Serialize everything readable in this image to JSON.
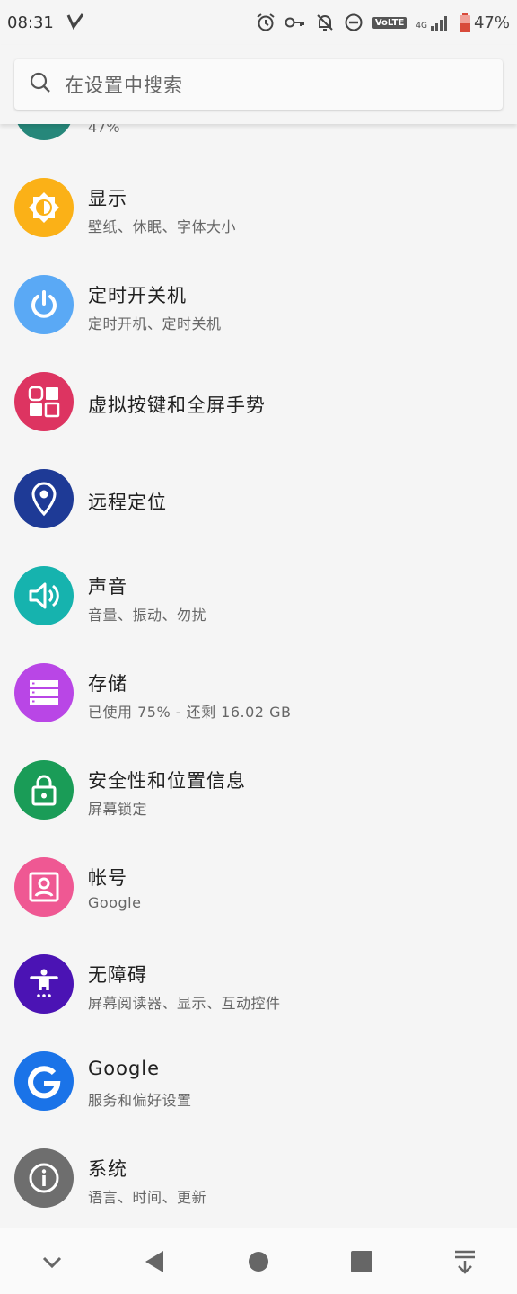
{
  "status_bar": {
    "time": "08:31",
    "volte": "VoLTE",
    "battery_percent": "47%",
    "network": "4G",
    "icons": [
      "vpn-check-icon",
      "alarm-icon",
      "key-icon",
      "notifications-off-icon",
      "do-not-disturb-icon",
      "volte-icon",
      "signal-icon",
      "battery-icon"
    ]
  },
  "search": {
    "placeholder": "在设置中搜索"
  },
  "partial_item": {
    "subtitle": "47%",
    "color": "#26877a"
  },
  "settings": [
    {
      "id": "display",
      "title": "显示",
      "subtitle": "壁纸、休眠、字体大小",
      "color": "#fbb117",
      "icon": "brightness-icon"
    },
    {
      "id": "schedule-power",
      "title": "定时开关机",
      "subtitle": "定时开机、定时关机",
      "color": "#5aa9f5",
      "icon": "power-icon"
    },
    {
      "id": "nav-gestures",
      "title": "虚拟按键和全屏手势",
      "subtitle": "",
      "color": "#dd3461",
      "icon": "apps-icon"
    },
    {
      "id": "remote-location",
      "title": "远程定位",
      "subtitle": "",
      "color": "#1e3a96",
      "icon": "location-pin-icon"
    },
    {
      "id": "sound",
      "title": "声音",
      "subtitle": "音量、振动、勿扰",
      "color": "#16b3ae",
      "icon": "volume-icon"
    },
    {
      "id": "storage",
      "title": "存储",
      "subtitle": "已使用 75% - 还剩 16.02 GB",
      "color": "#b946e6",
      "icon": "storage-icon"
    },
    {
      "id": "security",
      "title": "安全性和位置信息",
      "subtitle": "屏幕锁定",
      "color": "#1a9c57",
      "icon": "lock-icon"
    },
    {
      "id": "accounts",
      "title": "帐号",
      "subtitle": "Google",
      "color": "#ef5893",
      "icon": "account-box-icon"
    },
    {
      "id": "accessibility",
      "title": "无障碍",
      "subtitle": "屏幕阅读器、显示、互动控件",
      "color": "#4b13b4",
      "icon": "accessibility-icon"
    },
    {
      "id": "google",
      "title": "Google",
      "subtitle": "服务和偏好设置",
      "color": "#1a73e8",
      "icon": "google-icon"
    },
    {
      "id": "system",
      "title": "系统",
      "subtitle": "语言、时间、更新",
      "color": "#6e6e6e",
      "icon": "info-icon"
    }
  ],
  "nav_bar": {
    "buttons": [
      "chevron-down-icon",
      "back-icon",
      "home-icon",
      "recents-icon",
      "pull-down-icon"
    ]
  }
}
